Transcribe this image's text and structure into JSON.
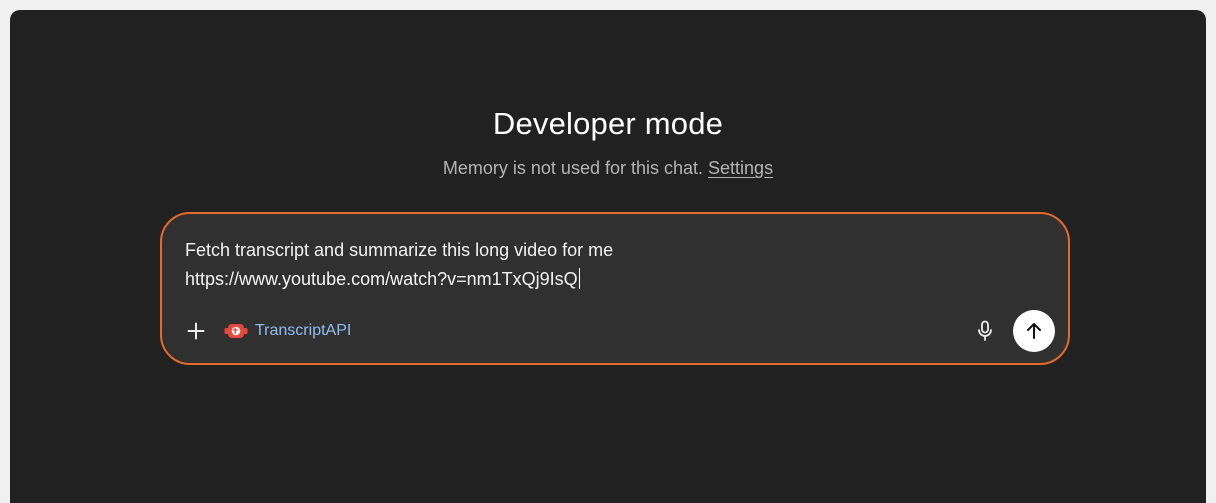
{
  "header": {
    "title": "Developer mode",
    "subtitle_text": "Memory is not used for this chat.",
    "settings_link": "Settings"
  },
  "composer": {
    "prompt_line1": "Fetch transcript and summarize this long video for me",
    "prompt_line2": "https://www.youtube.com/watch?v=nm1TxQj9IsQ",
    "add_icon": "plus-icon",
    "tool": {
      "label": "TranscriptAPI",
      "icon": "transcriptapi-logo-icon",
      "color": "#8fbcf2"
    },
    "mic_icon": "microphone-icon",
    "send_icon": "arrow-up-icon"
  },
  "colors": {
    "background": "#212121",
    "composer_bg": "#303030",
    "composer_border": "#e5692a",
    "brand_icon": "#e8483b"
  }
}
